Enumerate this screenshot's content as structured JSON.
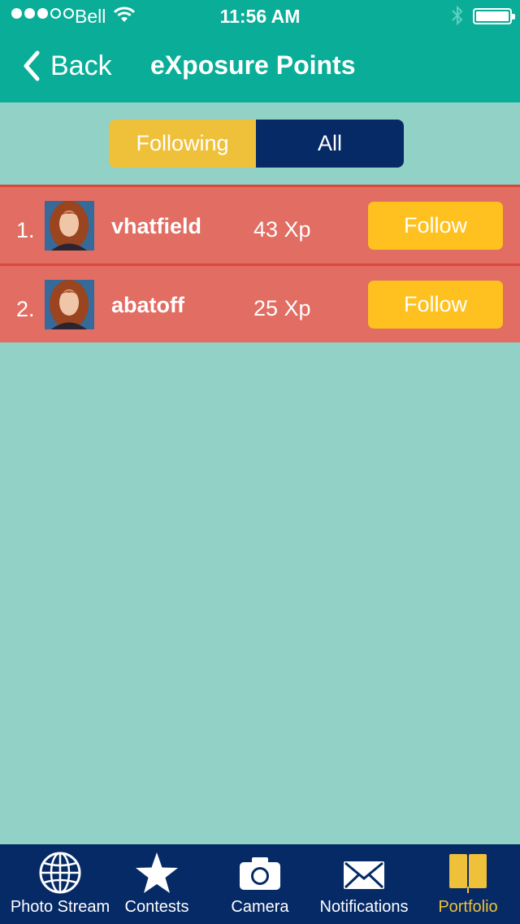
{
  "status_bar": {
    "carrier": "Bell",
    "time": "11:56 AM",
    "signal_bars_filled": 3,
    "signal_bars_total": 5,
    "battery_level": 1.0
  },
  "nav": {
    "back_label": "Back",
    "title": "eXposure Points"
  },
  "segments": {
    "following_label": "Following",
    "all_label": "All",
    "selected": "All"
  },
  "leaderboard": [
    {
      "rank": "1.",
      "username": "vhatfield",
      "points": "43 Xp",
      "follow_label": "Follow"
    },
    {
      "rank": "2.",
      "username": "abatoff",
      "points": "25 Xp",
      "follow_label": "Follow"
    }
  ],
  "tabbar": {
    "items": [
      {
        "label": "Photo Stream",
        "icon": "globe-icon"
      },
      {
        "label": "Contests",
        "icon": "star-icon"
      },
      {
        "label": "Camera",
        "icon": "camera-icon"
      },
      {
        "label": "Notifications",
        "icon": "envelope-icon"
      },
      {
        "label": "Portfolio",
        "icon": "book-icon"
      }
    ],
    "active": "Portfolio"
  },
  "colors": {
    "header": "#0aae98",
    "background": "#92d1c5",
    "row": "#e16d63",
    "row_divider": "#d9493b",
    "follow_button": "#ffc11f",
    "segment_following": "#efc03a",
    "segment_all": "#062a66",
    "tabbar": "#062a66",
    "tab_active": "#efc03a"
  }
}
